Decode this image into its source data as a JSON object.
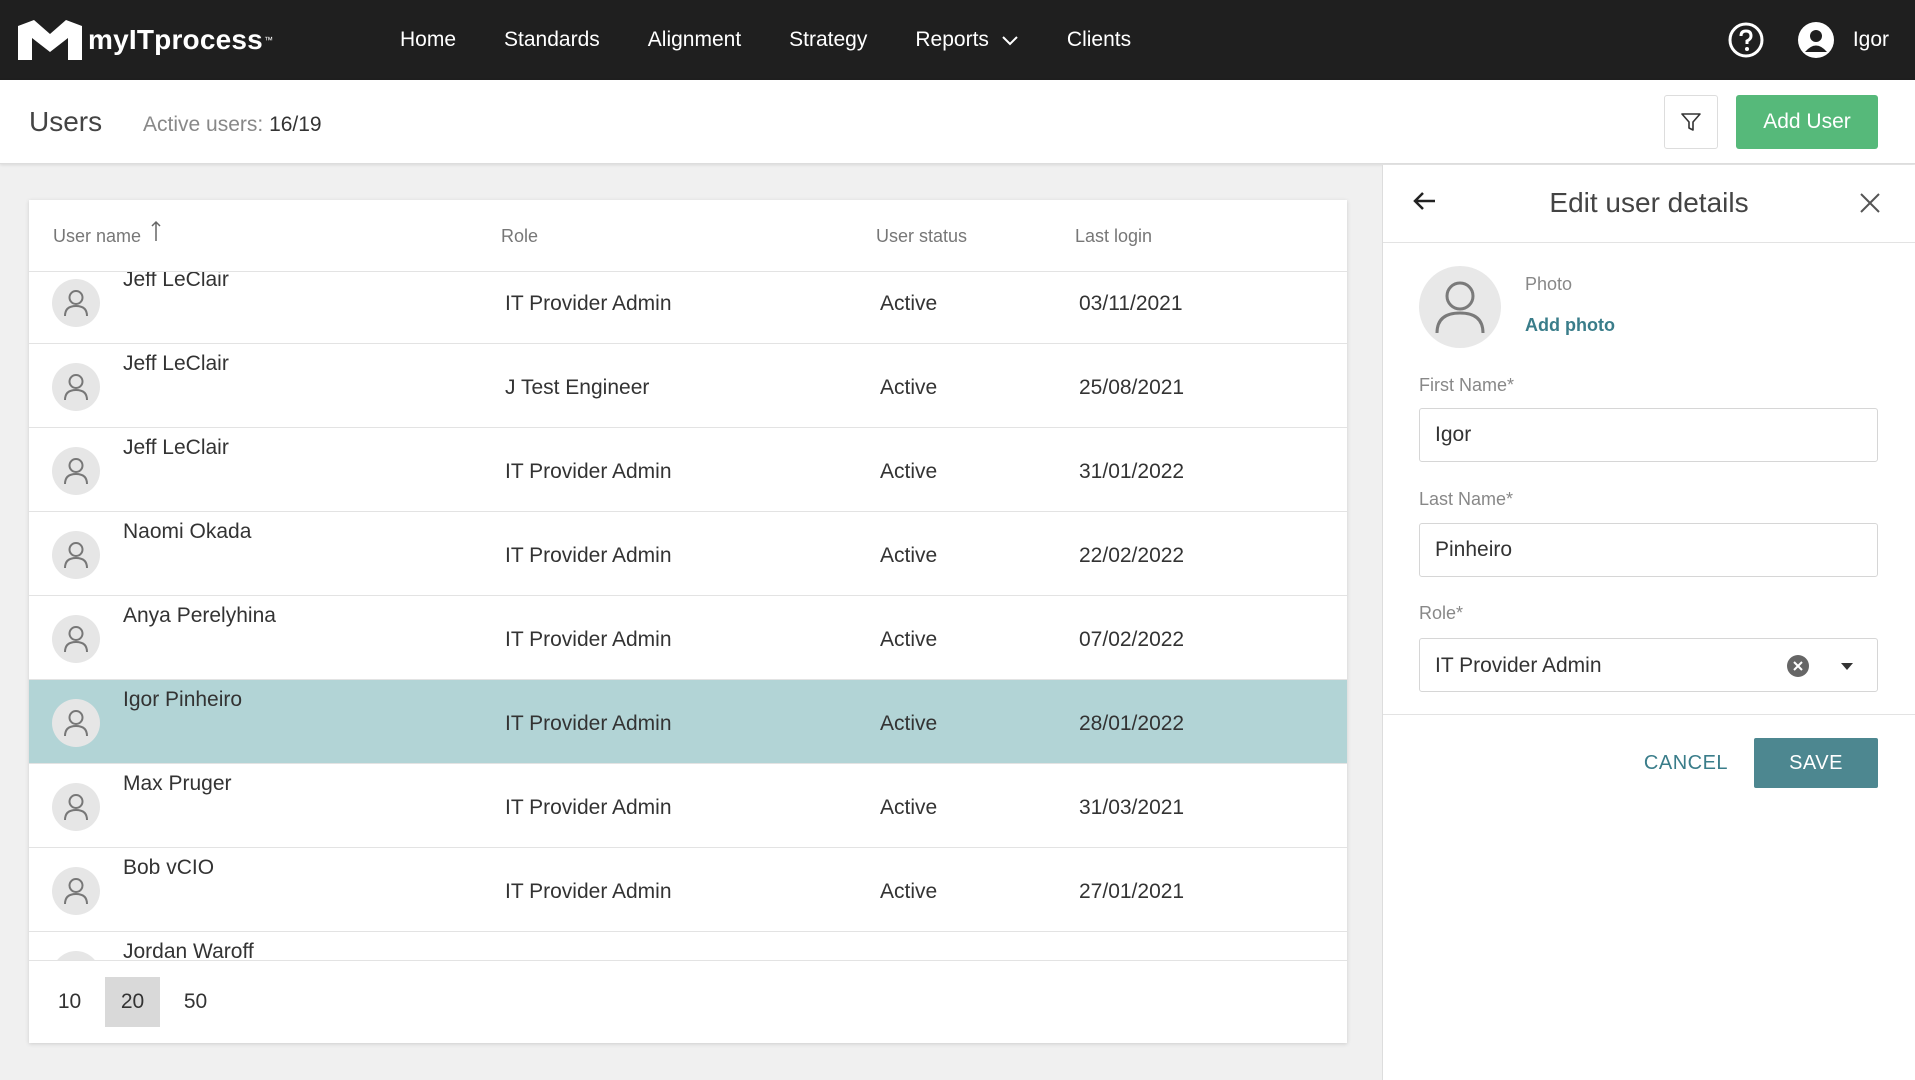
{
  "app": {
    "logo_text": "myITprocess",
    "logo_tm": "™"
  },
  "nav": {
    "items": [
      {
        "label": "Home"
      },
      {
        "label": "Standards"
      },
      {
        "label": "Alignment"
      },
      {
        "label": "Strategy"
      },
      {
        "label": "Reports"
      },
      {
        "label": "Clients"
      }
    ],
    "user_name": "Igor"
  },
  "header": {
    "title": "Users",
    "active_users_label": "Active users:",
    "active_users_count": "16/19",
    "add_user_label": "Add User"
  },
  "table": {
    "columns": {
      "name": "User name",
      "role": "Role",
      "status": "User status",
      "last_login": "Last login"
    },
    "rows": [
      {
        "name": "Jeff LeClair",
        "role": "IT Provider Admin",
        "status": "Active",
        "last_login": "03/11/2021",
        "selected": false
      },
      {
        "name": "Jeff LeClair",
        "role": "J Test Engineer",
        "status": "Active",
        "last_login": "25/08/2021",
        "selected": false
      },
      {
        "name": "Jeff LeClair",
        "role": "IT Provider Admin",
        "status": "Active",
        "last_login": "31/01/2022",
        "selected": false
      },
      {
        "name": "Naomi Okada",
        "role": "IT Provider Admin",
        "status": "Active",
        "last_login": "22/02/2022",
        "selected": false
      },
      {
        "name": "Anya Perelyhina",
        "role": "IT Provider Admin",
        "status": "Active",
        "last_login": "07/02/2022",
        "selected": false
      },
      {
        "name": "Igor Pinheiro",
        "role": "IT Provider Admin",
        "status": "Active",
        "last_login": "28/01/2022",
        "selected": true
      },
      {
        "name": "Max Pruger",
        "role": "IT Provider Admin",
        "status": "Active",
        "last_login": "31/03/2021",
        "selected": false
      },
      {
        "name": "Bob vCIO",
        "role": "IT Provider Admin",
        "status": "Active",
        "last_login": "27/01/2021",
        "selected": false
      },
      {
        "name": "Jordan Waroff",
        "role": "",
        "status": "",
        "last_login": "",
        "selected": false
      }
    ],
    "page_sizes": [
      "10",
      "20",
      "50"
    ],
    "active_page_size": "20"
  },
  "panel": {
    "title": "Edit user details",
    "photo_label": "Photo",
    "add_photo_label": "Add photo",
    "first_name_label": "First Name*",
    "first_name_value": "Igor",
    "last_name_label": "Last Name*",
    "last_name_value": "Pinheiro",
    "role_label": "Role*",
    "role_value": "IT Provider Admin",
    "cancel_label": "CANCEL",
    "save_label": "SAVE"
  },
  "colors": {
    "topbar": "#1f1f1f",
    "add_user": "#56b97a",
    "selected_row": "#b2d4d6",
    "save_button": "#4d8790",
    "link": "#3a7d8a"
  }
}
